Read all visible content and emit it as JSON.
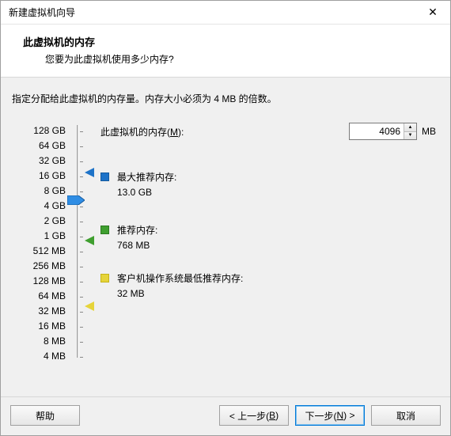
{
  "window": {
    "title": "新建虚拟机向导",
    "close": "✕"
  },
  "header": {
    "title": "此虚拟机的内存",
    "subtitle": "您要为此虚拟机使用多少内存?"
  },
  "description": "指定分配给此虚拟机的内存量。内存大小必须为 4 MB 的倍数。",
  "memory": {
    "label_prefix": "此虚拟机的内存(",
    "label_hotkey": "M",
    "label_suffix": "):",
    "value": "4096",
    "unit": "MB"
  },
  "scale": [
    "128 GB",
    "64 GB",
    "32 GB",
    "16 GB",
    "8 GB",
    "4 GB",
    "2 GB",
    "1 GB",
    "512 MB",
    "256 MB",
    "128 MB",
    "64 MB",
    "32 MB",
    "16 MB",
    "8 MB",
    "4 MB"
  ],
  "legend": {
    "max": {
      "title": "最大推荐内存:",
      "value": "13.0 GB"
    },
    "rec": {
      "title": "推荐内存:",
      "value": "768 MB"
    },
    "min": {
      "title": "客户机操作系统最低推荐内存:",
      "value": "32 MB"
    }
  },
  "buttons": {
    "help": "帮助",
    "back_pre": "< 上一步(",
    "back_key": "B",
    "back_suf": ")",
    "next_pre": "下一步(",
    "next_key": "N",
    "next_suf": ") >",
    "cancel": "取消"
  }
}
